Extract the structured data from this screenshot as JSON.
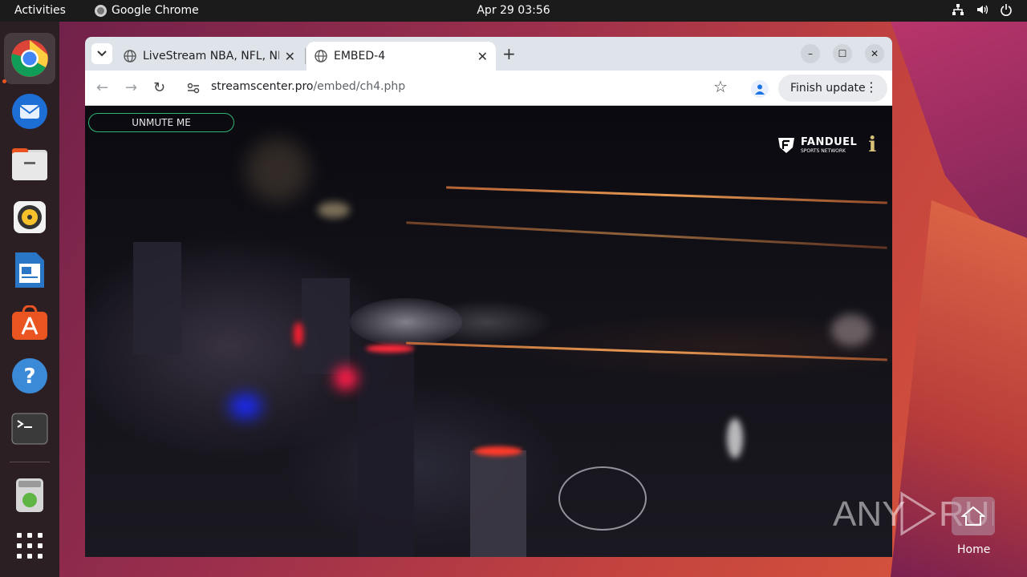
{
  "topbar": {
    "activities": "Activities",
    "app_name": "Google Chrome",
    "clock": "Apr 29  03:56",
    "tray_icons": [
      "network-icon",
      "volume-icon",
      "power-icon"
    ]
  },
  "dock": {
    "items": [
      "chrome-icon",
      "thunderbird-icon",
      "files-icon",
      "rhythmbox-icon",
      "writer-icon",
      "app-center-icon",
      "help-icon",
      "terminal-icon",
      "trash-icon",
      "app-grid-icon"
    ]
  },
  "browser": {
    "tabs": [
      {
        "title": "LiveStream NBA, NFL, NHL",
        "active": false
      },
      {
        "title": "EMBED-4",
        "active": true
      }
    ],
    "url_host": "streamscenter.pro",
    "url_path": "/embed/ch4.php",
    "finish_update": "Finish update"
  },
  "video": {
    "unmute": "UNMUTE ME",
    "logo_main": "FANDUEL",
    "logo_sub": "SPORTS NETWORK"
  },
  "desktop": {
    "home_label": "Home",
    "watermark": "ANY RUN"
  },
  "colors": {
    "accent": "#e95420",
    "unmute_border": "#2fb573"
  }
}
